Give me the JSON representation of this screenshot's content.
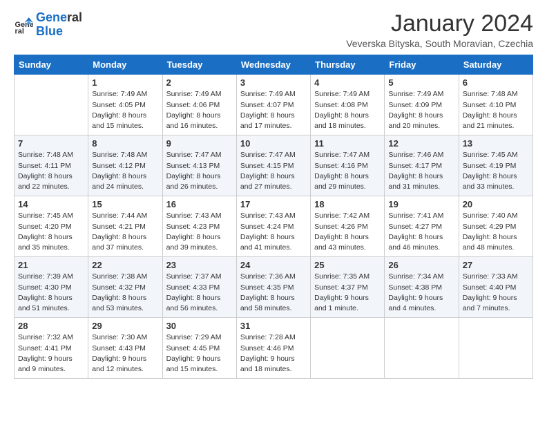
{
  "logo": {
    "line1": "General",
    "line2": "Blue"
  },
  "title": "January 2024",
  "subtitle": "Veverska Bityska, South Moravian, Czechia",
  "weekdays": [
    "Sunday",
    "Monday",
    "Tuesday",
    "Wednesday",
    "Thursday",
    "Friday",
    "Saturday"
  ],
  "weeks": [
    [
      {
        "day": "",
        "sunrise": "",
        "sunset": "",
        "daylight": ""
      },
      {
        "day": "1",
        "sunrise": "Sunrise: 7:49 AM",
        "sunset": "Sunset: 4:05 PM",
        "daylight": "Daylight: 8 hours and 15 minutes."
      },
      {
        "day": "2",
        "sunrise": "Sunrise: 7:49 AM",
        "sunset": "Sunset: 4:06 PM",
        "daylight": "Daylight: 8 hours and 16 minutes."
      },
      {
        "day": "3",
        "sunrise": "Sunrise: 7:49 AM",
        "sunset": "Sunset: 4:07 PM",
        "daylight": "Daylight: 8 hours and 17 minutes."
      },
      {
        "day": "4",
        "sunrise": "Sunrise: 7:49 AM",
        "sunset": "Sunset: 4:08 PM",
        "daylight": "Daylight: 8 hours and 18 minutes."
      },
      {
        "day": "5",
        "sunrise": "Sunrise: 7:49 AM",
        "sunset": "Sunset: 4:09 PM",
        "daylight": "Daylight: 8 hours and 20 minutes."
      },
      {
        "day": "6",
        "sunrise": "Sunrise: 7:48 AM",
        "sunset": "Sunset: 4:10 PM",
        "daylight": "Daylight: 8 hours and 21 minutes."
      }
    ],
    [
      {
        "day": "7",
        "sunrise": "Sunrise: 7:48 AM",
        "sunset": "Sunset: 4:11 PM",
        "daylight": "Daylight: 8 hours and 22 minutes."
      },
      {
        "day": "8",
        "sunrise": "Sunrise: 7:48 AM",
        "sunset": "Sunset: 4:12 PM",
        "daylight": "Daylight: 8 hours and 24 minutes."
      },
      {
        "day": "9",
        "sunrise": "Sunrise: 7:47 AM",
        "sunset": "Sunset: 4:13 PM",
        "daylight": "Daylight: 8 hours and 26 minutes."
      },
      {
        "day": "10",
        "sunrise": "Sunrise: 7:47 AM",
        "sunset": "Sunset: 4:15 PM",
        "daylight": "Daylight: 8 hours and 27 minutes."
      },
      {
        "day": "11",
        "sunrise": "Sunrise: 7:47 AM",
        "sunset": "Sunset: 4:16 PM",
        "daylight": "Daylight: 8 hours and 29 minutes."
      },
      {
        "day": "12",
        "sunrise": "Sunrise: 7:46 AM",
        "sunset": "Sunset: 4:17 PM",
        "daylight": "Daylight: 8 hours and 31 minutes."
      },
      {
        "day": "13",
        "sunrise": "Sunrise: 7:45 AM",
        "sunset": "Sunset: 4:19 PM",
        "daylight": "Daylight: 8 hours and 33 minutes."
      }
    ],
    [
      {
        "day": "14",
        "sunrise": "Sunrise: 7:45 AM",
        "sunset": "Sunset: 4:20 PM",
        "daylight": "Daylight: 8 hours and 35 minutes."
      },
      {
        "day": "15",
        "sunrise": "Sunrise: 7:44 AM",
        "sunset": "Sunset: 4:21 PM",
        "daylight": "Daylight: 8 hours and 37 minutes."
      },
      {
        "day": "16",
        "sunrise": "Sunrise: 7:43 AM",
        "sunset": "Sunset: 4:23 PM",
        "daylight": "Daylight: 8 hours and 39 minutes."
      },
      {
        "day": "17",
        "sunrise": "Sunrise: 7:43 AM",
        "sunset": "Sunset: 4:24 PM",
        "daylight": "Daylight: 8 hours and 41 minutes."
      },
      {
        "day": "18",
        "sunrise": "Sunrise: 7:42 AM",
        "sunset": "Sunset: 4:26 PM",
        "daylight": "Daylight: 8 hours and 43 minutes."
      },
      {
        "day": "19",
        "sunrise": "Sunrise: 7:41 AM",
        "sunset": "Sunset: 4:27 PM",
        "daylight": "Daylight: 8 hours and 46 minutes."
      },
      {
        "day": "20",
        "sunrise": "Sunrise: 7:40 AM",
        "sunset": "Sunset: 4:29 PM",
        "daylight": "Daylight: 8 hours and 48 minutes."
      }
    ],
    [
      {
        "day": "21",
        "sunrise": "Sunrise: 7:39 AM",
        "sunset": "Sunset: 4:30 PM",
        "daylight": "Daylight: 8 hours and 51 minutes."
      },
      {
        "day": "22",
        "sunrise": "Sunrise: 7:38 AM",
        "sunset": "Sunset: 4:32 PM",
        "daylight": "Daylight: 8 hours and 53 minutes."
      },
      {
        "day": "23",
        "sunrise": "Sunrise: 7:37 AM",
        "sunset": "Sunset: 4:33 PM",
        "daylight": "Daylight: 8 hours and 56 minutes."
      },
      {
        "day": "24",
        "sunrise": "Sunrise: 7:36 AM",
        "sunset": "Sunset: 4:35 PM",
        "daylight": "Daylight: 8 hours and 58 minutes."
      },
      {
        "day": "25",
        "sunrise": "Sunrise: 7:35 AM",
        "sunset": "Sunset: 4:37 PM",
        "daylight": "Daylight: 9 hours and 1 minute."
      },
      {
        "day": "26",
        "sunrise": "Sunrise: 7:34 AM",
        "sunset": "Sunset: 4:38 PM",
        "daylight": "Daylight: 9 hours and 4 minutes."
      },
      {
        "day": "27",
        "sunrise": "Sunrise: 7:33 AM",
        "sunset": "Sunset: 4:40 PM",
        "daylight": "Daylight: 9 hours and 7 minutes."
      }
    ],
    [
      {
        "day": "28",
        "sunrise": "Sunrise: 7:32 AM",
        "sunset": "Sunset: 4:41 PM",
        "daylight": "Daylight: 9 hours and 9 minutes."
      },
      {
        "day": "29",
        "sunrise": "Sunrise: 7:30 AM",
        "sunset": "Sunset: 4:43 PM",
        "daylight": "Daylight: 9 hours and 12 minutes."
      },
      {
        "day": "30",
        "sunrise": "Sunrise: 7:29 AM",
        "sunset": "Sunset: 4:45 PM",
        "daylight": "Daylight: 9 hours and 15 minutes."
      },
      {
        "day": "31",
        "sunrise": "Sunrise: 7:28 AM",
        "sunset": "Sunset: 4:46 PM",
        "daylight": "Daylight: 9 hours and 18 minutes."
      },
      {
        "day": "",
        "sunrise": "",
        "sunset": "",
        "daylight": ""
      },
      {
        "day": "",
        "sunrise": "",
        "sunset": "",
        "daylight": ""
      },
      {
        "day": "",
        "sunrise": "",
        "sunset": "",
        "daylight": ""
      }
    ]
  ]
}
